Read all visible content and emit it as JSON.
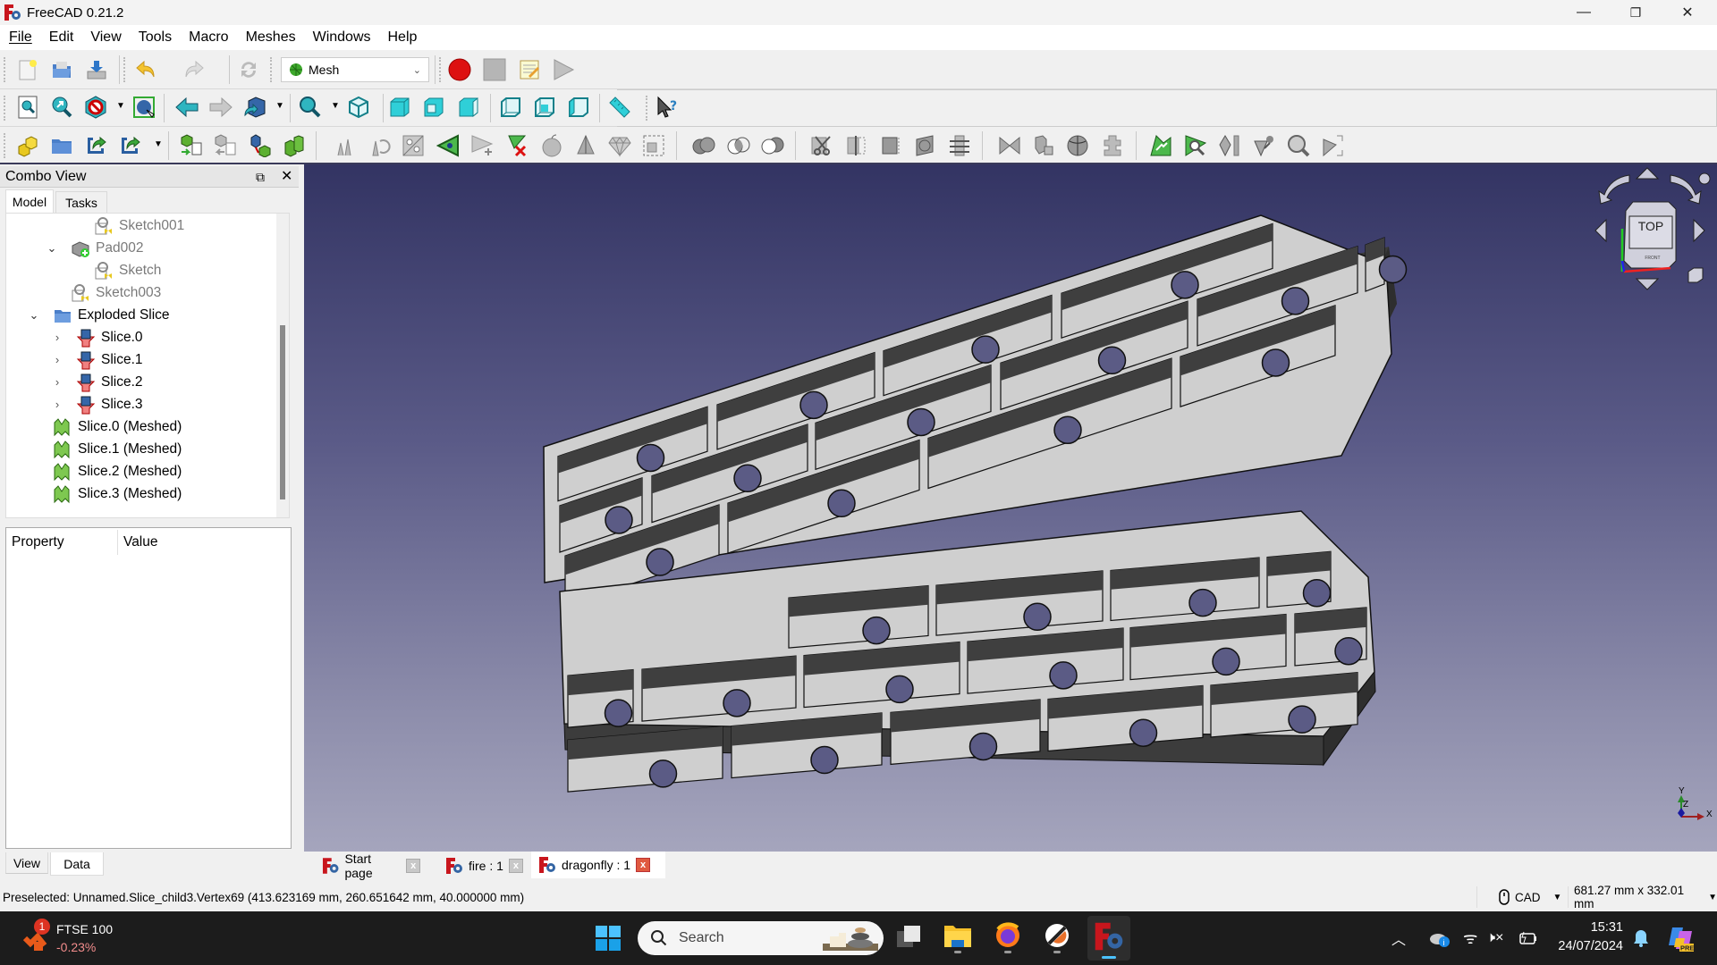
{
  "app": {
    "title": "FreeCAD 0.21.2",
    "window_controls": {
      "minimize": "—",
      "maximize": "❐",
      "close": "✕"
    }
  },
  "menubar": {
    "items": [
      {
        "label": "File",
        "accel": "F"
      },
      {
        "label": "Edit",
        "accel": "E"
      },
      {
        "label": "View",
        "accel": "V"
      },
      {
        "label": "Tools",
        "accel": "T"
      },
      {
        "label": "Macro",
        "accel": "M"
      },
      {
        "label": "Meshes",
        "accel": "M"
      },
      {
        "label": "Windows",
        "accel": "W"
      },
      {
        "label": "Help",
        "accel": "H"
      }
    ]
  },
  "toolbar": {
    "workbench_selector": {
      "selected": "Mesh",
      "icon": "mesh-workbench-icon"
    },
    "row1_icons": [
      "new-document-icon",
      "open-document-icon",
      "save-document-icon",
      "undo-icon",
      "redo-icon",
      "refresh-icon",
      "macro-record-icon",
      "macro-stop-icon",
      "macro-edit-icon",
      "macro-execute-icon"
    ],
    "row2_icons": [
      "fit-all-icon",
      "fit-selection-icon",
      "draw-style-icon",
      "bounding-box-icon",
      "back-icon",
      "forward-icon",
      "sync-view-icon",
      "zoom-icon",
      "isometric-view-icon",
      "front-view-icon",
      "top-view-icon",
      "right-view-icon",
      "rear-view-icon",
      "bottom-view-icon",
      "left-view-icon",
      "measure-distance-icon",
      "whats-this-icon"
    ],
    "row3_icons": [
      "create-part-icon",
      "create-group-icon",
      "create-link-icon",
      "link-actions-icon",
      "import-mesh-icon",
      "export-mesh-icon",
      "mesh-from-shape-icon",
      "remesh-gmsh-icon",
      "evaluate-solid-icon",
      "harmonize-normals-icon",
      "flip-normals-icon",
      "fill-holes-icon",
      "add-triangle-icon",
      "remove-components-icon",
      "smooth-icon",
      "decimation-icon",
      "scale-icon",
      "bounding-box-mesh-icon",
      "union-icon",
      "intersection-icon",
      "difference-icon",
      "cut-mesh-icon",
      "trim-mesh-icon",
      "trim-by-plane-icon",
      "cross-section-icon",
      "cross-sections-icon",
      "segmentation-icon",
      "segmentation-best-fit-icon",
      "curvature-icon",
      "merge-icon",
      "analyze-icon",
      "evaluate-fix-icon",
      "vertex-curvature-icon",
      "curvature-info-icon",
      "evaluate-defects-icon",
      "split-components-icon"
    ]
  },
  "combo_view": {
    "title": "Combo View",
    "tabs": [
      {
        "label": "Model",
        "active": true
      },
      {
        "label": "Tasks",
        "active": false
      }
    ],
    "tree": [
      {
        "label": "Sketch001",
        "icon": "sketch-icon",
        "level": 3,
        "expander": "",
        "dimmed": true
      },
      {
        "label": "Pad002",
        "icon": "pad-icon",
        "level": 2,
        "expander": "⌄",
        "dimmed": true
      },
      {
        "label": "Sketch",
        "icon": "sketch-icon",
        "level": 3,
        "expander": "",
        "dimmed": true
      },
      {
        "label": "Sketch003",
        "icon": "sketch-icon",
        "level": 2,
        "expander": "",
        "dimmed": true
      },
      {
        "label": "Exploded Slice",
        "icon": "folder-icon",
        "level": 1,
        "expander": "⌄",
        "dimmed": false
      },
      {
        "label": "Slice.0",
        "icon": "slice-part-icon",
        "level": 2,
        "expander": "›",
        "dimmed": false
      },
      {
        "label": "Slice.1",
        "icon": "slice-part-icon",
        "level": 2,
        "expander": "›",
        "dimmed": false
      },
      {
        "label": "Slice.2",
        "icon": "slice-part-icon",
        "level": 2,
        "expander": "›",
        "dimmed": false
      },
      {
        "label": "Slice.3",
        "icon": "slice-part-icon",
        "level": 2,
        "expander": "›",
        "dimmed": false
      },
      {
        "label": "Slice.0 (Meshed)",
        "icon": "mesh-feature-icon",
        "level": 1,
        "expander": "",
        "dimmed": false
      },
      {
        "label": "Slice.1 (Meshed)",
        "icon": "mesh-feature-icon",
        "level": 1,
        "expander": "",
        "dimmed": false
      },
      {
        "label": "Slice.2 (Meshed)",
        "icon": "mesh-feature-icon",
        "level": 1,
        "expander": "",
        "dimmed": false
      },
      {
        "label": "Slice.3 (Meshed)",
        "icon": "mesh-feature-icon",
        "level": 1,
        "expander": "",
        "dimmed": false
      }
    ],
    "property_header": {
      "property": "Property",
      "value": "Value"
    },
    "bottom_tabs": [
      {
        "label": "View",
        "active": false
      },
      {
        "label": "Data",
        "active": true
      }
    ]
  },
  "viewport": {
    "nav_cube": {
      "face": "TOP",
      "lower_face": "FRONT"
    },
    "axis_labels": {
      "x": "X",
      "y": "Y",
      "z": "Z"
    },
    "colors": {
      "bg_top": "#333463",
      "bg_bottom": "#a5a5bd",
      "face": "#cfcfcf",
      "wall": "#3f3f3f",
      "hole": "#5b5b85"
    }
  },
  "doc_tabs": [
    {
      "label": "Start page",
      "active": false
    },
    {
      "label": "fire : 1",
      "active": false
    },
    {
      "label": "dragonfly : 1",
      "active": true
    }
  ],
  "statusbar": {
    "message": "Preselected: Unnamed.Slice_child3.Vertex69 (413.623169 mm, 260.651642 mm, 40.000000 mm)",
    "nav_style": "CAD",
    "dimensions": "681.27 mm x 332.01 mm"
  },
  "taskbar": {
    "widget": {
      "name": "FTSE 100",
      "change": "-0.23%",
      "badge": "1"
    },
    "search_placeholder": "Search",
    "apps": [
      "task-view-icon",
      "file-explorer-icon",
      "firefox-icon",
      "app-icon",
      "freecad-icon"
    ],
    "clock": {
      "time": "15:31",
      "date": "24/07/2024"
    },
    "copilot_badge": "PRE"
  }
}
